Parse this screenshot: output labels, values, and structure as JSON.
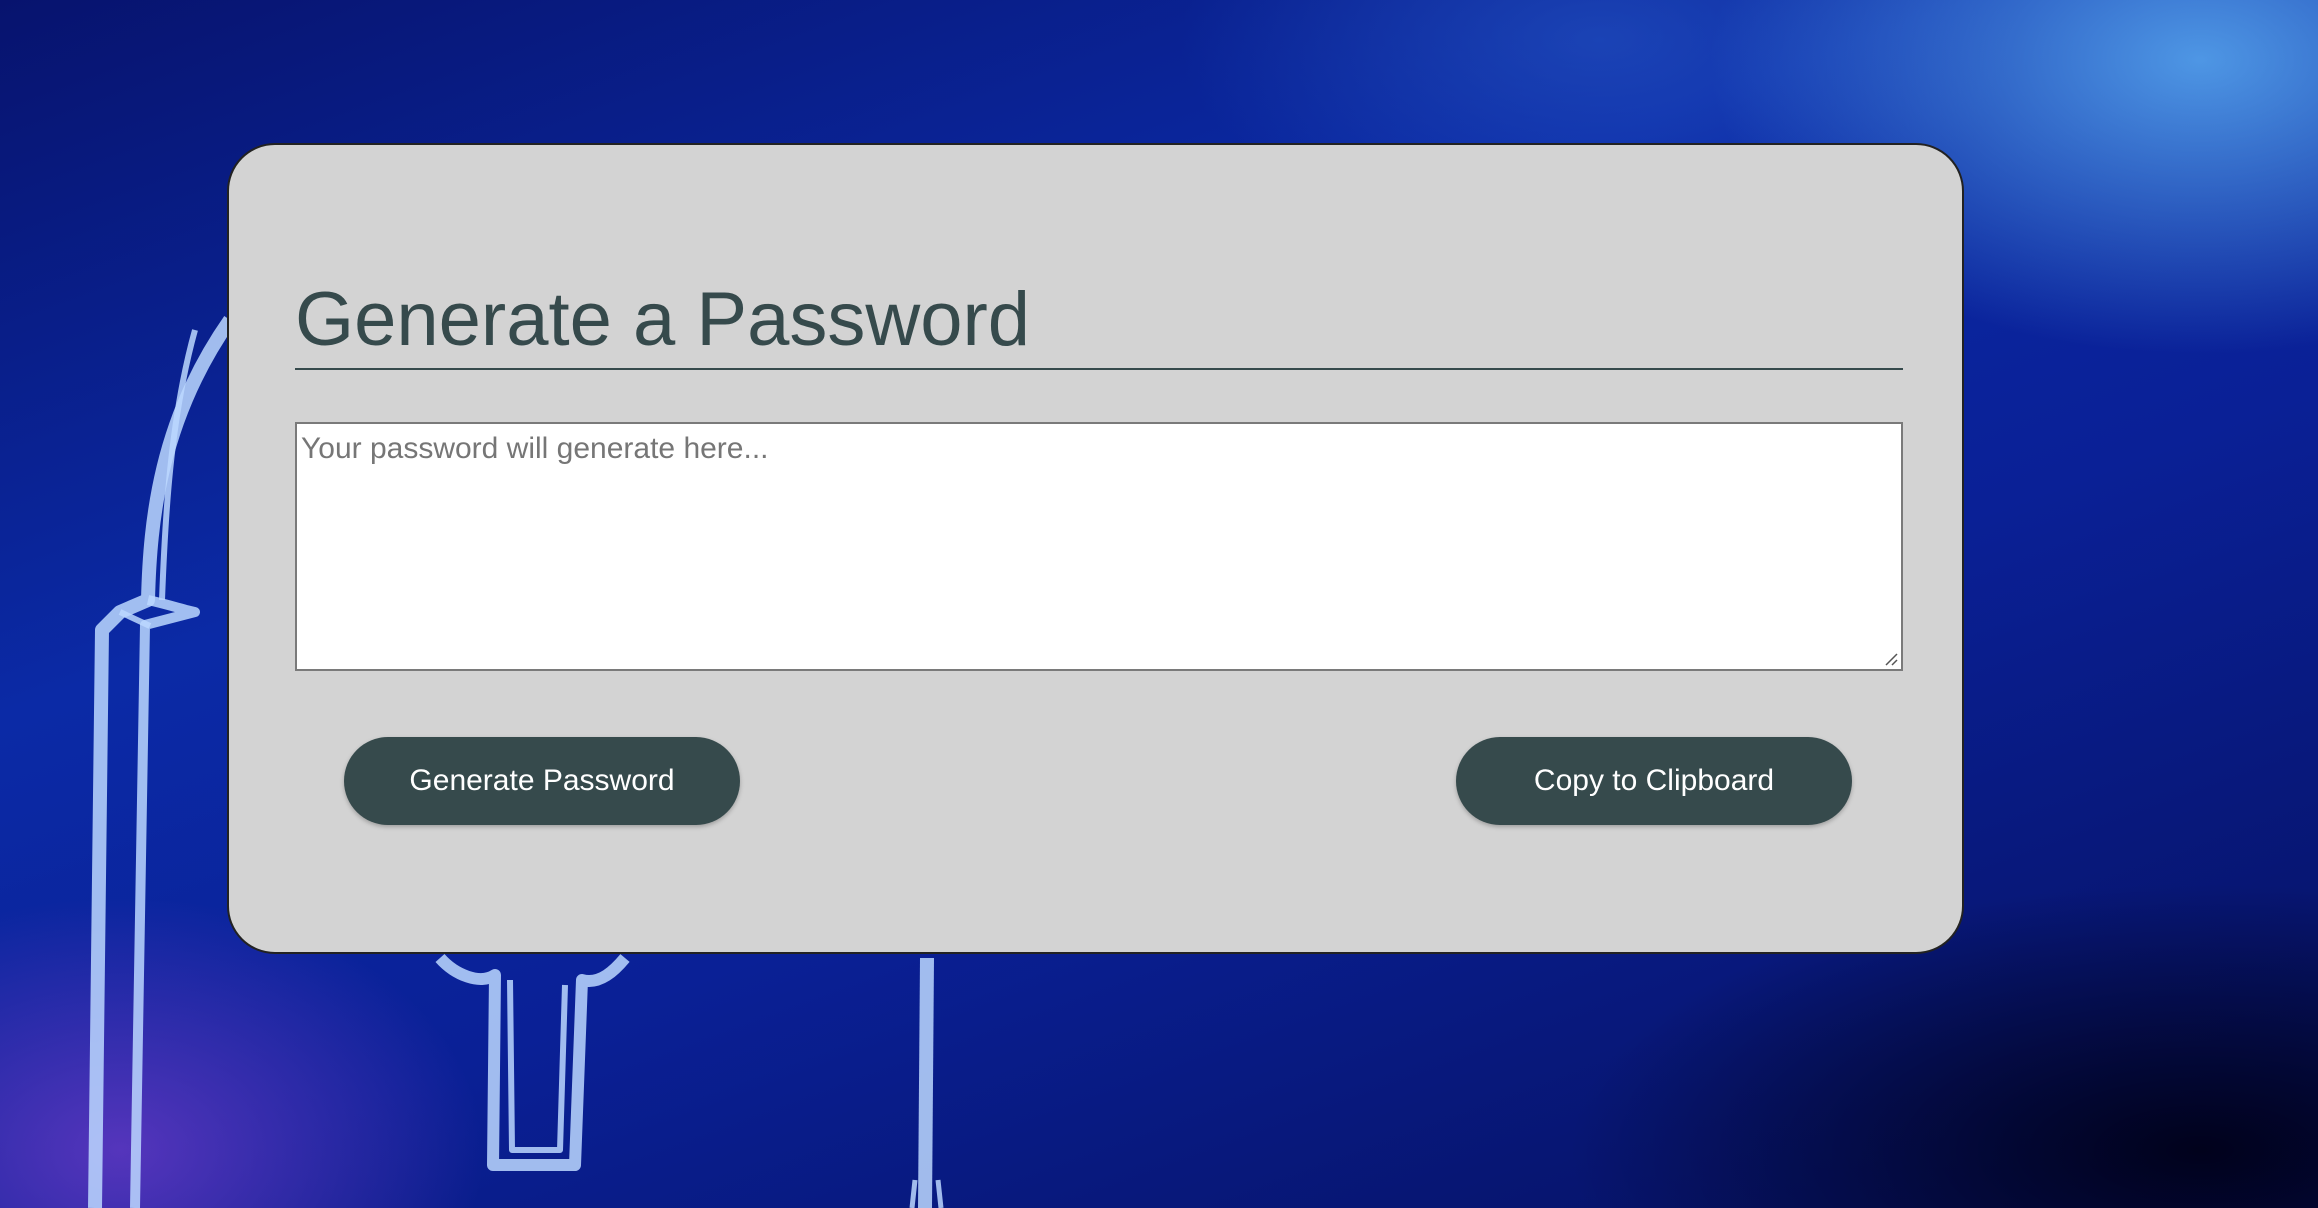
{
  "page": {
    "title": "Generate a Password"
  },
  "password_output": {
    "placeholder": "Your password will generate here...",
    "value": ""
  },
  "actions": {
    "generate_label": "Generate Password",
    "copy_label": "Copy to Clipboard"
  },
  "colors": {
    "card_background": "#d3d3d3",
    "accent": "#364a4c",
    "button_text": "#ffffff",
    "background_blue": "#0b2aa6"
  },
  "icons": {
    "background_art": "padlock-icon"
  }
}
